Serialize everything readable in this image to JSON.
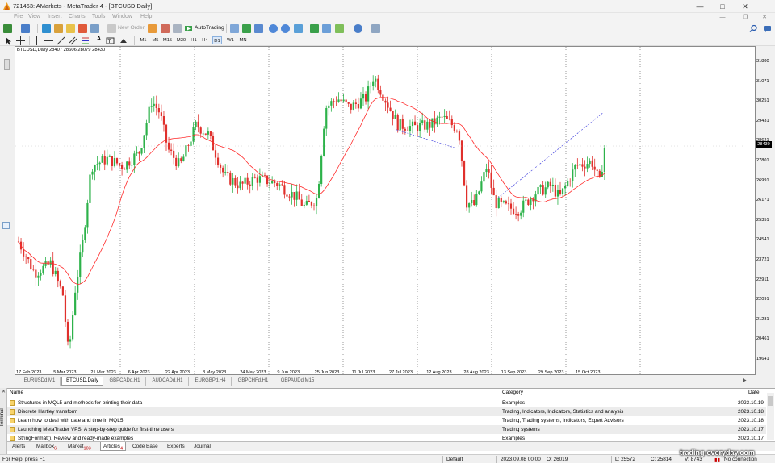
{
  "window": {
    "title": "721463: AMarkets - MetaTrader 4 - [BTCUSD,Daily]"
  },
  "menu": [
    "File",
    "View",
    "Insert",
    "Charts",
    "Tools",
    "Window",
    "Help"
  ],
  "toolbar": {
    "new_order": "New Order",
    "autotrading": "AutoTrading",
    "timeframes": [
      "M1",
      "M5",
      "M15",
      "M30",
      "H1",
      "H4",
      "D1",
      "W1",
      "MN"
    ]
  },
  "chart": {
    "info": "BTCUSD,Daily  28407 28606 28079 28430",
    "current_price": "28430",
    "price_labels": [
      "31880",
      "31071",
      "30251",
      "29431",
      "28621",
      "27801",
      "26991",
      "26171",
      "25351",
      "24541",
      "23721",
      "22911",
      "22091",
      "21281",
      "20461",
      "19641"
    ],
    "date_labels": [
      "17 Feb 2023",
      "5 Mar 2023",
      "21 Mar 2023",
      "6 Apr 2023",
      "22 Apr 2023",
      "8 May 2023",
      "24 May 2023",
      "9 Jun 2023",
      "25 Jun 2023",
      "11 Jul 2023",
      "27 Jul 2023",
      "12 Aug 2023",
      "28 Aug 2023",
      "13 Sep 2023",
      "29 Sep 2023",
      "15 Oct 2023"
    ],
    "colors": {
      "bull": "#2db24a",
      "bear": "#e0302c",
      "ma": "#ff2a2a",
      "trend": "#4a4adf"
    }
  },
  "chart_tabs": [
    "EURUSDd,M1",
    "BTCUSD,Daily",
    "GBPCADd,H1",
    "AUDCADd,H1",
    "EURGBPd,H4",
    "GBPCHFd,H1",
    "GBPAUDd,M15"
  ],
  "terminal": {
    "side_label": "Terminal",
    "columns": {
      "name": "Name",
      "category": "Category",
      "date": "Date"
    },
    "rows": [
      {
        "name": "Structures in MQL5 and methods for printing their data",
        "category": "Examples",
        "date": "2023.10.19"
      },
      {
        "name": "Discrete Hartley transform",
        "category": "Trading, Indicators, Indicators, Statistics and analysis",
        "date": "2023.10.18"
      },
      {
        "name": "Learn how to deal with date and time in MQL5",
        "category": "Trading, Trading systems, Indicators, Expert Advisors",
        "date": "2023.10.18"
      },
      {
        "name": "Launching MetaTrader VPS: A step-by-step guide for first-time users",
        "category": "Trading systems",
        "date": "2023.10.17"
      },
      {
        "name": "StringFormat(). Review and ready-made examples",
        "category": "Examples",
        "date": "2023.10.17"
      }
    ],
    "tabs": [
      {
        "label": "Alerts",
        "count": ""
      },
      {
        "label": "Mailbox",
        "count": "6"
      },
      {
        "label": "Market",
        "count": "103"
      },
      {
        "label": "Articles",
        "count": "4"
      },
      {
        "label": "Code Base",
        "count": ""
      },
      {
        "label": "Experts",
        "count": ""
      },
      {
        "label": "Journal",
        "count": ""
      }
    ]
  },
  "status": {
    "help": "For Help, press F1",
    "profile": "Default",
    "datetime": "2023.09.08 00:00",
    "open": "O: 26019",
    "low": "L: 25572",
    "close": "C: 25814",
    "volume": "V: 8743",
    "connection": "No connection"
  },
  "watermark": "trading-everyday.com"
}
